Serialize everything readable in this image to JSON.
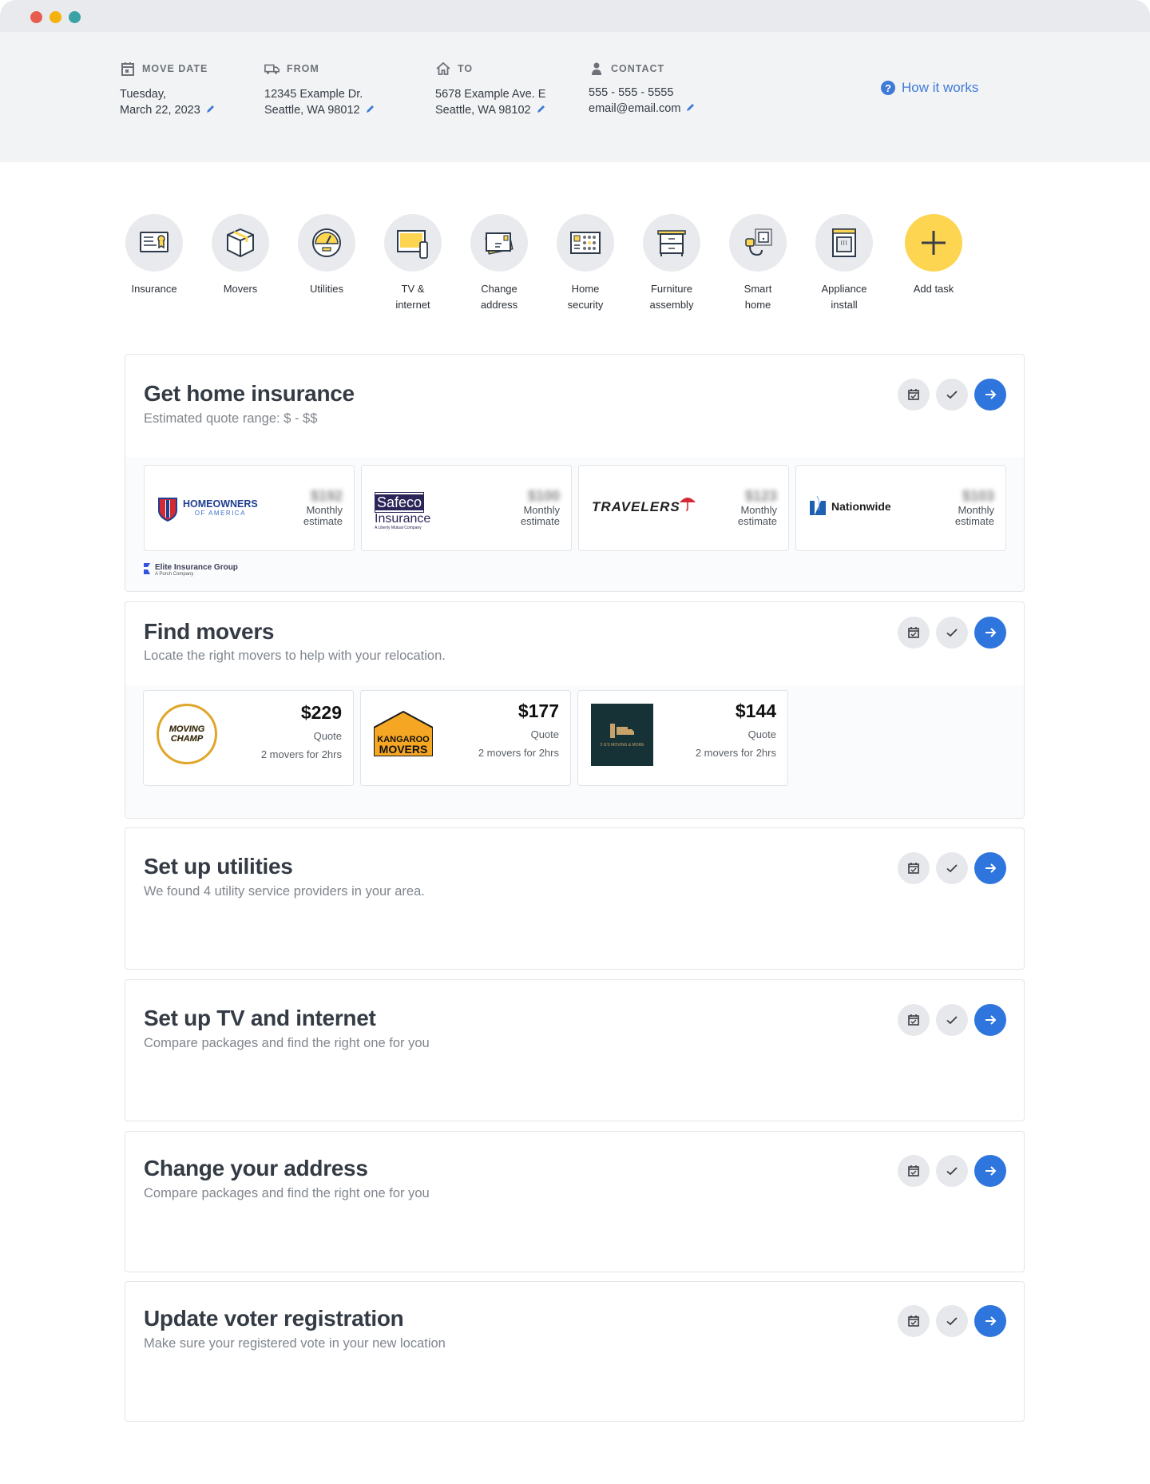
{
  "window": {
    "controls": [
      "close",
      "minimize",
      "maximize"
    ]
  },
  "move_info": {
    "move_date": {
      "label": "MOVE DATE",
      "line1": "Tuesday,",
      "line2": "March 22, 2023",
      "icon": "calendar-icon"
    },
    "from": {
      "label": "FROM",
      "line1": "12345 Example Dr.",
      "line2": "Seattle, WA 98012",
      "icon": "truck-icon"
    },
    "to": {
      "label": "TO",
      "line1": "5678 Example Ave. E",
      "line2": "Seattle, WA 98102",
      "icon": "home-icon"
    },
    "contact": {
      "label": "CONTACT",
      "line1": "555 - 555 - 5555",
      "line2": "email@email.com",
      "icon": "person-icon"
    },
    "how_it_works": "How it works"
  },
  "categories": [
    {
      "label": "Insurance",
      "icon": "certificate-icon"
    },
    {
      "label": "Movers",
      "icon": "box-icon"
    },
    {
      "label": "Utilities",
      "icon": "meter-icon"
    },
    {
      "label": "TV &\ninternet",
      "icon": "tv-icon"
    },
    {
      "label": "Change\naddress",
      "icon": "envelope-icon"
    },
    {
      "label": "Home\nsecurity",
      "icon": "keypad-icon"
    },
    {
      "label": "Furniture\nassembly",
      "icon": "dresser-icon"
    },
    {
      "label": "Smart\nhome",
      "icon": "plug-icon"
    },
    {
      "label": "Appliance\ninstall",
      "icon": "oven-icon"
    },
    {
      "label": "Add task",
      "icon": "plus-icon"
    }
  ],
  "tasks": [
    {
      "title": "Get home insurance",
      "subtitle": "Estimated quote range: $ - $$",
      "providers": [
        {
          "name": "HOMEOWNERS",
          "sub": "OF AMERICA",
          "price": "$192",
          "price_label_1": "Monthly",
          "price_label_2": "estimate"
        },
        {
          "name": "Safeco",
          "sub": "Insurance",
          "tagline": "A Liberty Mutual Company",
          "price": "$100",
          "price_label_1": "Monthly",
          "price_label_2": "estimate"
        },
        {
          "name": "TRAVELERS",
          "price": "$123",
          "price_label_1": "Monthly",
          "price_label_2": "estimate"
        },
        {
          "name": "Nationwide",
          "price": "$103",
          "price_label_1": "Monthly",
          "price_label_2": "estimate"
        }
      ],
      "partner": {
        "name": "Elite Insurance Group",
        "tagline": "A Porch Company"
      }
    },
    {
      "title": "Find movers",
      "subtitle": "Locate the right movers to help with your relocation.",
      "providers": [
        {
          "name": "MOVING CHAMP",
          "price": "$229",
          "quote_label": "Quote",
          "detail": "2 movers for 2hrs"
        },
        {
          "name": "KANGAROO MOVERS",
          "price": "$177",
          "quote_label": "Quote",
          "detail": "2 movers for 2hrs"
        },
        {
          "name": "3 G'S MOVING & MORE",
          "price": "$144",
          "quote_label": "Quote",
          "detail": "2 movers for 2hrs"
        }
      ]
    },
    {
      "title": "Set up utilities",
      "subtitle": "We found 4 utility service providers in your area."
    },
    {
      "title": "Set up TV and internet",
      "subtitle": "Compare packages and find the right one for you"
    },
    {
      "title": "Change your address",
      "subtitle": "Compare packages and find the right one for you"
    },
    {
      "title": "Update voter registration",
      "subtitle": "Make sure your registered vote in your new location"
    }
  ],
  "colors": {
    "accent_blue": "#2f75de",
    "accent_yellow": "#fdd551",
    "text_dark": "#343b44",
    "text_muted": "#80868d"
  }
}
